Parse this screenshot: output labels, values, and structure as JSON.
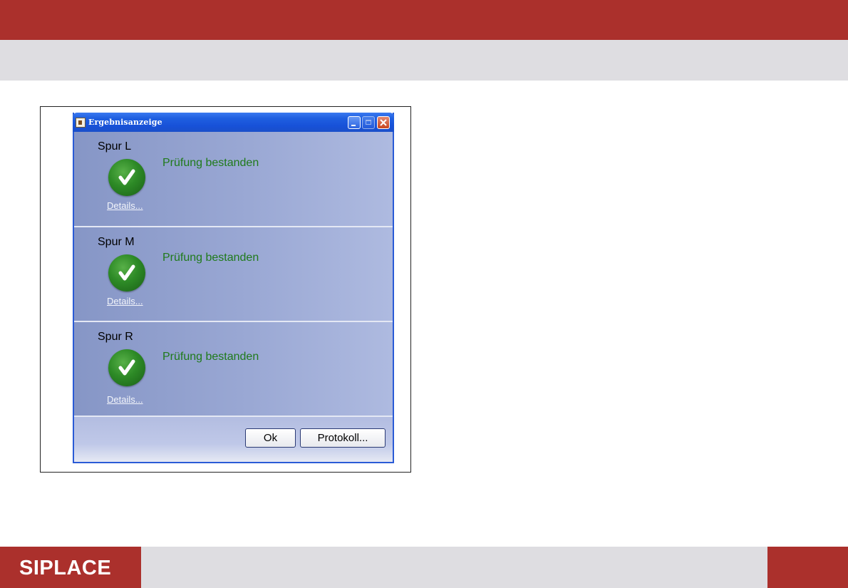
{
  "window": {
    "title": "Ergebnisanzeige"
  },
  "lanes": [
    {
      "label": "Spur L",
      "status": "Prüfung bestanden",
      "details_link": "Details..."
    },
    {
      "label": "Spur M",
      "status": "Prüfung bestanden",
      "details_link": "Details..."
    },
    {
      "label": "Spur R",
      "status": "Prüfung bestanden",
      "details_link": "Details..."
    }
  ],
  "buttons": {
    "ok": "Ok",
    "protocol": "Protokoll..."
  },
  "branding": {
    "logo": "SIPLACE"
  },
  "colors": {
    "brand_red": "#ab302c",
    "status_green": "#1f7a1a",
    "titlebar_blue": "#1f5fe0"
  }
}
